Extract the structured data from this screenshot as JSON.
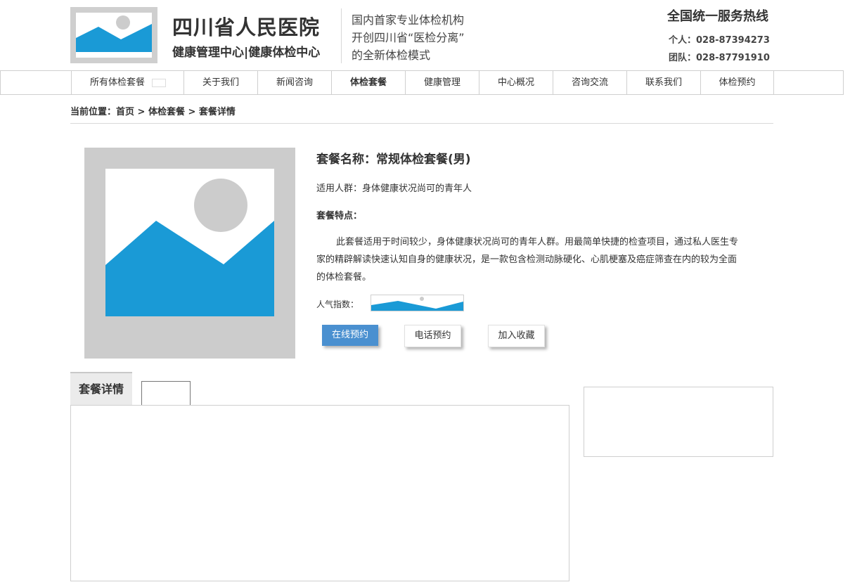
{
  "header": {
    "title": "四川省人民医院",
    "subtitle": "健康管理中心|健康体检中心",
    "slogan_lines": [
      "国内首家专业体检机构",
      "开创四川省“医检分离”",
      "的全新体检模式"
    ],
    "hotline_title": "全国统一服务热线",
    "hotline_personal": "个人：028-87394273",
    "hotline_group": "团队：028-87791910"
  },
  "nav": {
    "items": [
      {
        "label": "所有体检套餐"
      },
      {
        "label": "关于我们"
      },
      {
        "label": "新闻咨询"
      },
      {
        "label": "体检套餐"
      },
      {
        "label": "健康管理"
      },
      {
        "label": "中心概况"
      },
      {
        "label": "咨询交流"
      },
      {
        "label": "联系我们"
      },
      {
        "label": "体检预约"
      }
    ],
    "active_index": 3
  },
  "breadcrumb": {
    "text": "当前位置：首页 > 体检套餐  > 套餐详情"
  },
  "package": {
    "name": "套餐名称：常规体检套餐(男)",
    "audience": "适用人群：身体健康状况尚可的青年人",
    "features_label": "套餐特点：",
    "description": "此套餐适用于时间较少，身体健康状况尚可的青年人群。用最简单快捷的检查项目，通过私人医生专家的精辟解读快速认知自身的健康状况，是一款包含检测动脉硬化、心肌梗塞及癌症筛查在内的较为全面的体检套餐。",
    "popularity_label": "人气指数："
  },
  "buttons": {
    "online_booking": "在线预约",
    "phone_booking": "电话预约",
    "add_favorite": "加入收藏"
  },
  "tabs": {
    "details_label": "套餐详情"
  },
  "colors": {
    "image_placeholder_blue": "#1a9ad6",
    "image_placeholder_gray": "#cccccc",
    "button_primary": "#4a90d0"
  }
}
